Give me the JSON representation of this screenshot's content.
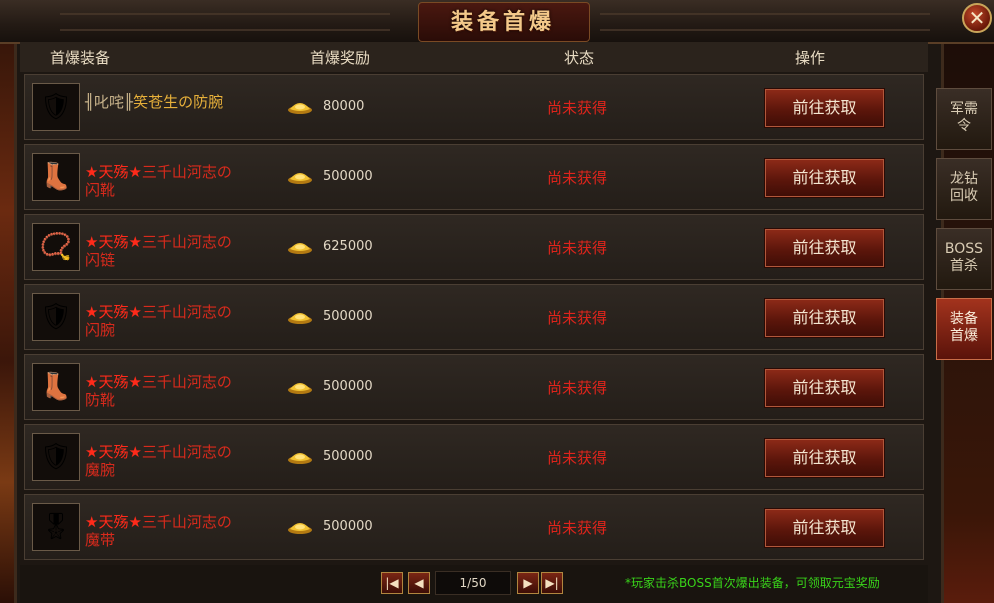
{
  "window": {
    "title": "装备首爆",
    "close_icon": "close-icon"
  },
  "table": {
    "headers": {
      "item": "首爆装备",
      "reward": "首爆奖励",
      "status": "状态",
      "action": "操作"
    },
    "rows": [
      {
        "name_prefix": "╢叱咤╟",
        "name": "笑苍生の防腕",
        "icon": "bracer-icon",
        "reward": "80000",
        "status": "尚未获得",
        "action": "前往获取"
      },
      {
        "name_prefix": "★天殇★",
        "name": "三千山河志の闪靴",
        "icon": "boots-icon",
        "reward": "500000",
        "status": "尚未获得",
        "action": "前往获取"
      },
      {
        "name_prefix": "★天殇★",
        "name": "三千山河志の闪链",
        "icon": "necklace-icon",
        "reward": "625000",
        "status": "尚未获得",
        "action": "前往获取"
      },
      {
        "name_prefix": "★天殇★",
        "name": "三千山河志の闪腕",
        "icon": "bracer-icon",
        "reward": "500000",
        "status": "尚未获得",
        "action": "前往获取"
      },
      {
        "name_prefix": "★天殇★",
        "name": "三千山河志の防靴",
        "icon": "boots-icon",
        "reward": "500000",
        "status": "尚未获得",
        "action": "前往获取"
      },
      {
        "name_prefix": "★天殇★",
        "name": "三千山河志の魔腕",
        "icon": "bracer-icon",
        "reward": "500000",
        "status": "尚未获得",
        "action": "前往获取"
      },
      {
        "name_prefix": "★天殇★",
        "name": "三千山河志の魔带",
        "icon": "belt-icon",
        "reward": "500000",
        "status": "尚未获得",
        "action": "前往获取"
      }
    ]
  },
  "pagination": {
    "page_text": "1/50"
  },
  "footer_note": "*玩家击杀BOSS首次爆出装备，可领取元宝奖励",
  "side_tabs": [
    {
      "line1": "军需",
      "line2": "令",
      "active": false
    },
    {
      "line1": "龙钻",
      "line2": "回收",
      "active": false
    },
    {
      "line1": "BOSS",
      "line2": "首杀",
      "active": false
    },
    {
      "line1": "装备",
      "line2": "首爆",
      "active": true
    }
  ],
  "colors": {
    "status_red": "#e0241b",
    "name_red": "#d82a1c",
    "name_gold": "#e7b03a",
    "note_green": "#39d41a",
    "active_tab": "#a3331d"
  }
}
